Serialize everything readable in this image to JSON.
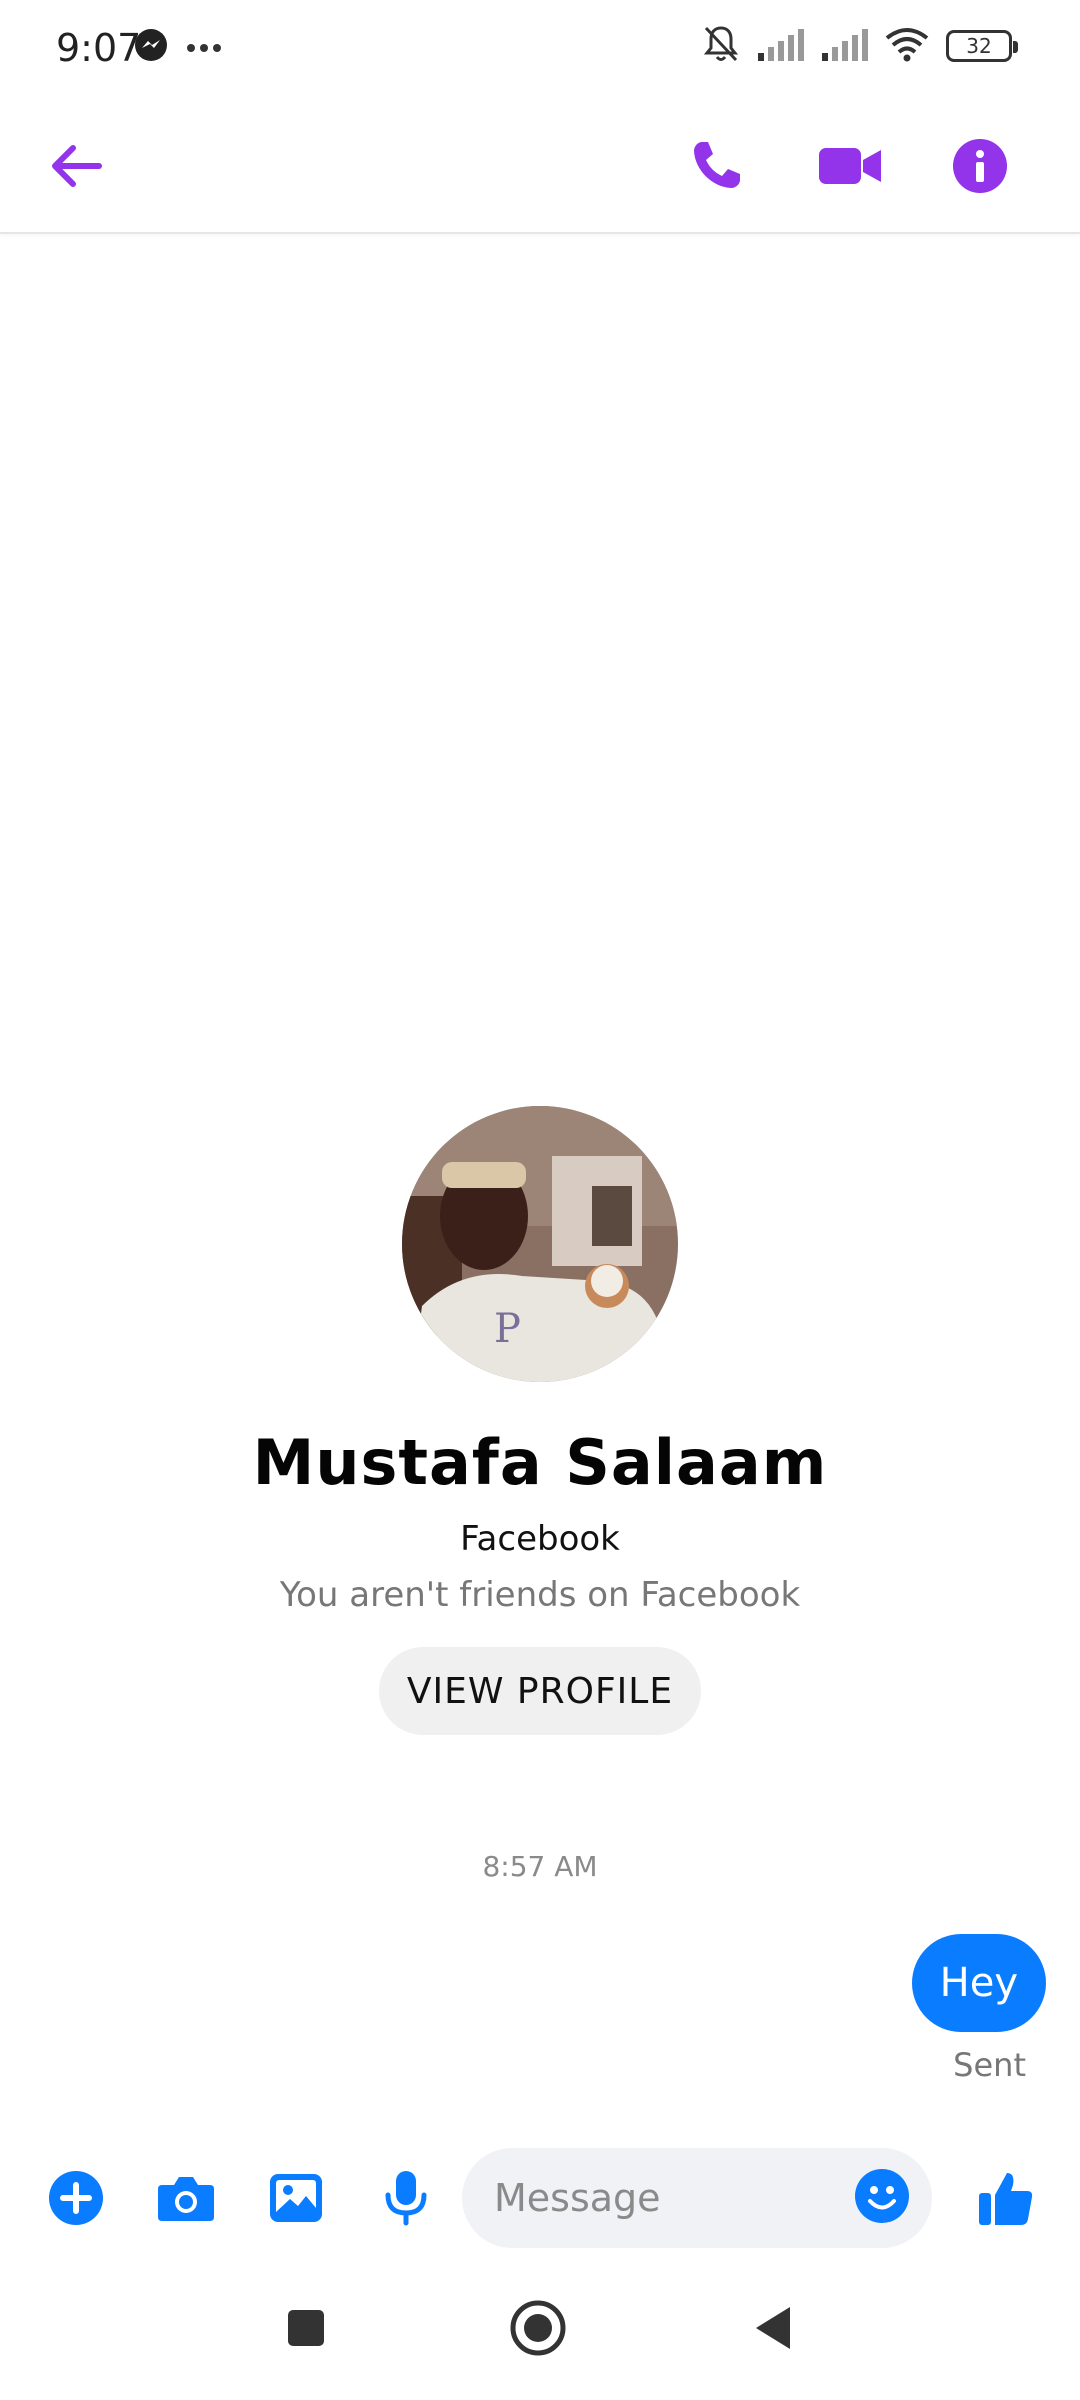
{
  "status_bar": {
    "time": "9:07",
    "battery_level": "32",
    "icons": [
      "messenger-icon",
      "more-dots-icon",
      "mute-bell-icon",
      "signal-icon",
      "signal-icon",
      "wifi-icon",
      "battery-icon"
    ]
  },
  "app_bar": {
    "icons": [
      "back-arrow-icon",
      "phone-icon",
      "video-camera-icon",
      "info-icon"
    ],
    "accent_color": "#9333ea"
  },
  "profile": {
    "name": "Mustafa Salaam",
    "platform": "Facebook",
    "relation": "You aren't friends on Facebook",
    "view_profile_label": "VIEW PROFILE"
  },
  "conversation": {
    "timestamp": "8:57 AM",
    "messages": [
      {
        "text": "Hey",
        "direction": "outgoing",
        "status": "Sent"
      }
    ],
    "bubble_color": "#0a7cff"
  },
  "composer": {
    "placeholder": "Message",
    "icons": [
      "plus-icon",
      "camera-icon",
      "gallery-icon",
      "microphone-icon",
      "emoji-icon",
      "thumbs-up-icon"
    ],
    "accent_color": "#0a7cff"
  },
  "nav_bar": {
    "icons": [
      "recents-square-icon",
      "home-circle-icon",
      "back-triangle-icon"
    ]
  }
}
